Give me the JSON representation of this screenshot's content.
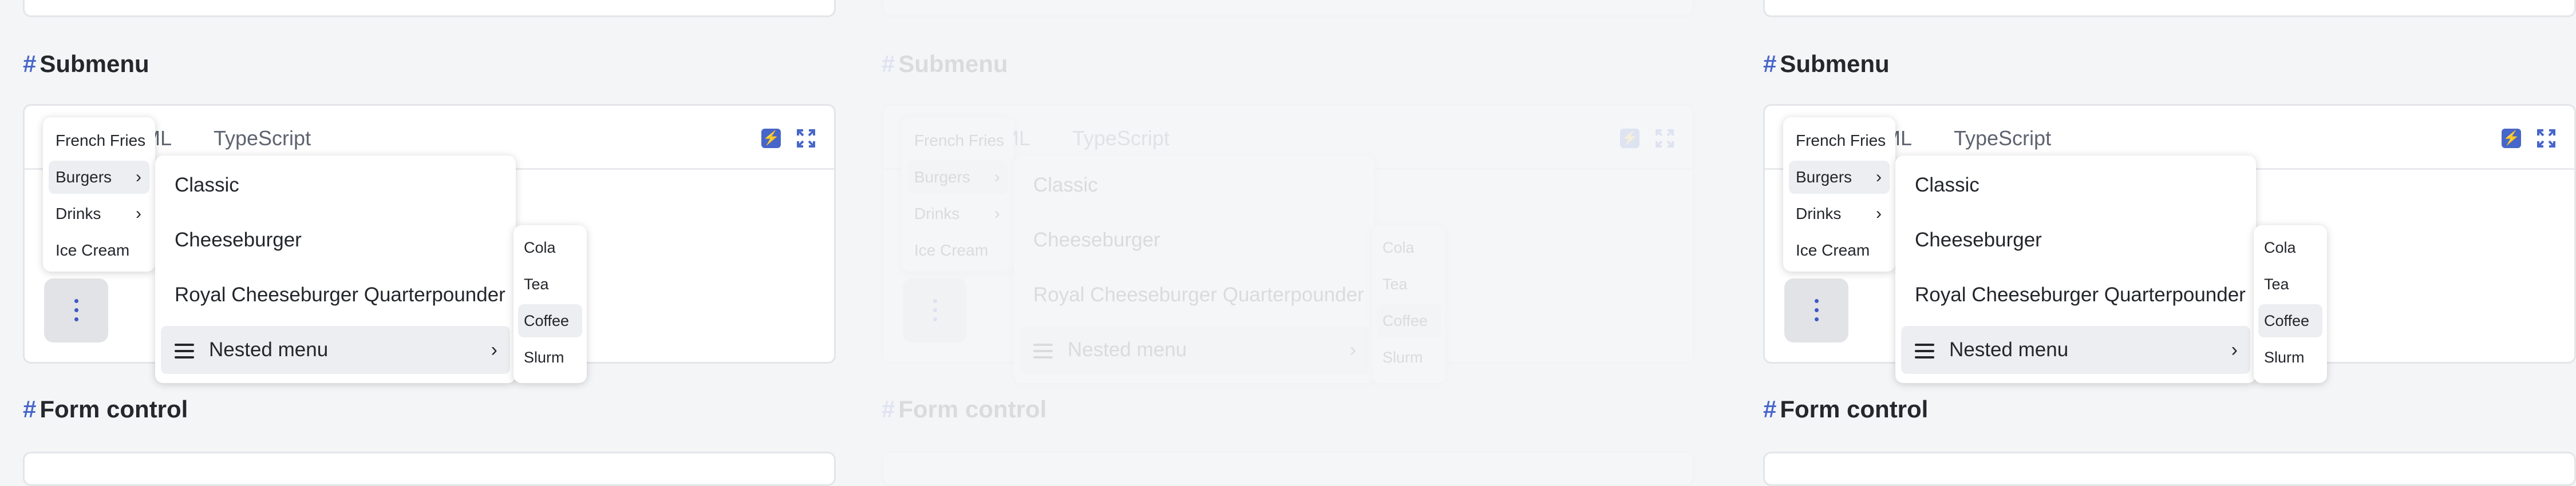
{
  "sections": {
    "submenu_title": "Submenu",
    "form_control_title": "Form control",
    "hash": "#"
  },
  "tabs": {
    "html": "TML",
    "typescript": "TypeScript"
  },
  "toolbar": {
    "bolt_icon": "bolt-icon",
    "expand_icon": "expand-icon",
    "bolt_glyph": "⚡"
  },
  "menu_level1": {
    "items": [
      {
        "label": "French Fries",
        "has_submenu": false
      },
      {
        "label": "Burgers",
        "has_submenu": true,
        "active": true
      },
      {
        "label": "Drinks",
        "has_submenu": true
      },
      {
        "label": "Ice Cream",
        "has_submenu": false
      }
    ]
  },
  "menu_level2": {
    "items": [
      {
        "label": "Classic"
      },
      {
        "label": "Cheeseburger"
      },
      {
        "label": "Royal Cheeseburger Quarterpounder"
      },
      {
        "label": "Nested menu",
        "has_submenu": true,
        "active": true,
        "icon": "menu-icon"
      }
    ]
  },
  "menu_level3": {
    "items": [
      {
        "label": "Cola"
      },
      {
        "label": "Tea"
      },
      {
        "label": "Coffee",
        "active": true
      },
      {
        "label": "Slurm"
      }
    ]
  },
  "colors": {
    "accent": "#4766c9",
    "menu_active_bg": "#eceef1",
    "kebab_bg": "#e2e3e6"
  }
}
